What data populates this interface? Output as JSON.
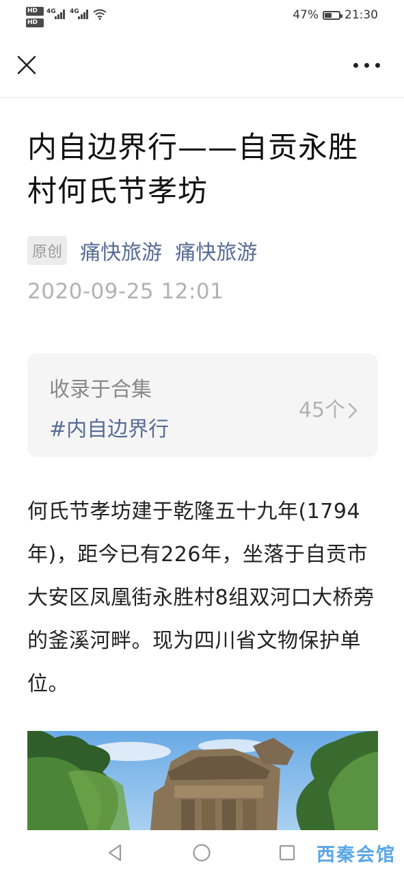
{
  "status_bar": {
    "hd1": "HD",
    "hd2": "HD",
    "net1": "4G",
    "net2": "4G",
    "battery_percent": "47%",
    "time": "21:30"
  },
  "nav": {
    "close_icon": "close-icon",
    "more_icon": "more-icon"
  },
  "article": {
    "title": "内自边界行——自贡永胜村何氏节孝坊",
    "original_badge": "原创",
    "author_1": "痛快旅游",
    "author_2": "痛快旅游",
    "date": "2020-09-25 12:01"
  },
  "collection": {
    "label": "收录于合集",
    "tag": "#内自边界行",
    "count": "45个"
  },
  "body": {
    "paragraph": "何氏节孝坊建于乾隆五十九年(1794年)，距今已有226年，坐落于自贡市大安区凤凰街永胜村8组双河口大桥旁的釜溪河畔。现为四川省文物保护单位。"
  },
  "system_nav": {
    "back_icon": "back-triangle-icon",
    "home_icon": "home-circle-icon",
    "recent_icon": "recent-square-icon",
    "watermark": "西秦会馆"
  },
  "colors": {
    "link": "#576b95",
    "muted": "#b2b2b2",
    "card_bg": "#f5f5f5"
  }
}
